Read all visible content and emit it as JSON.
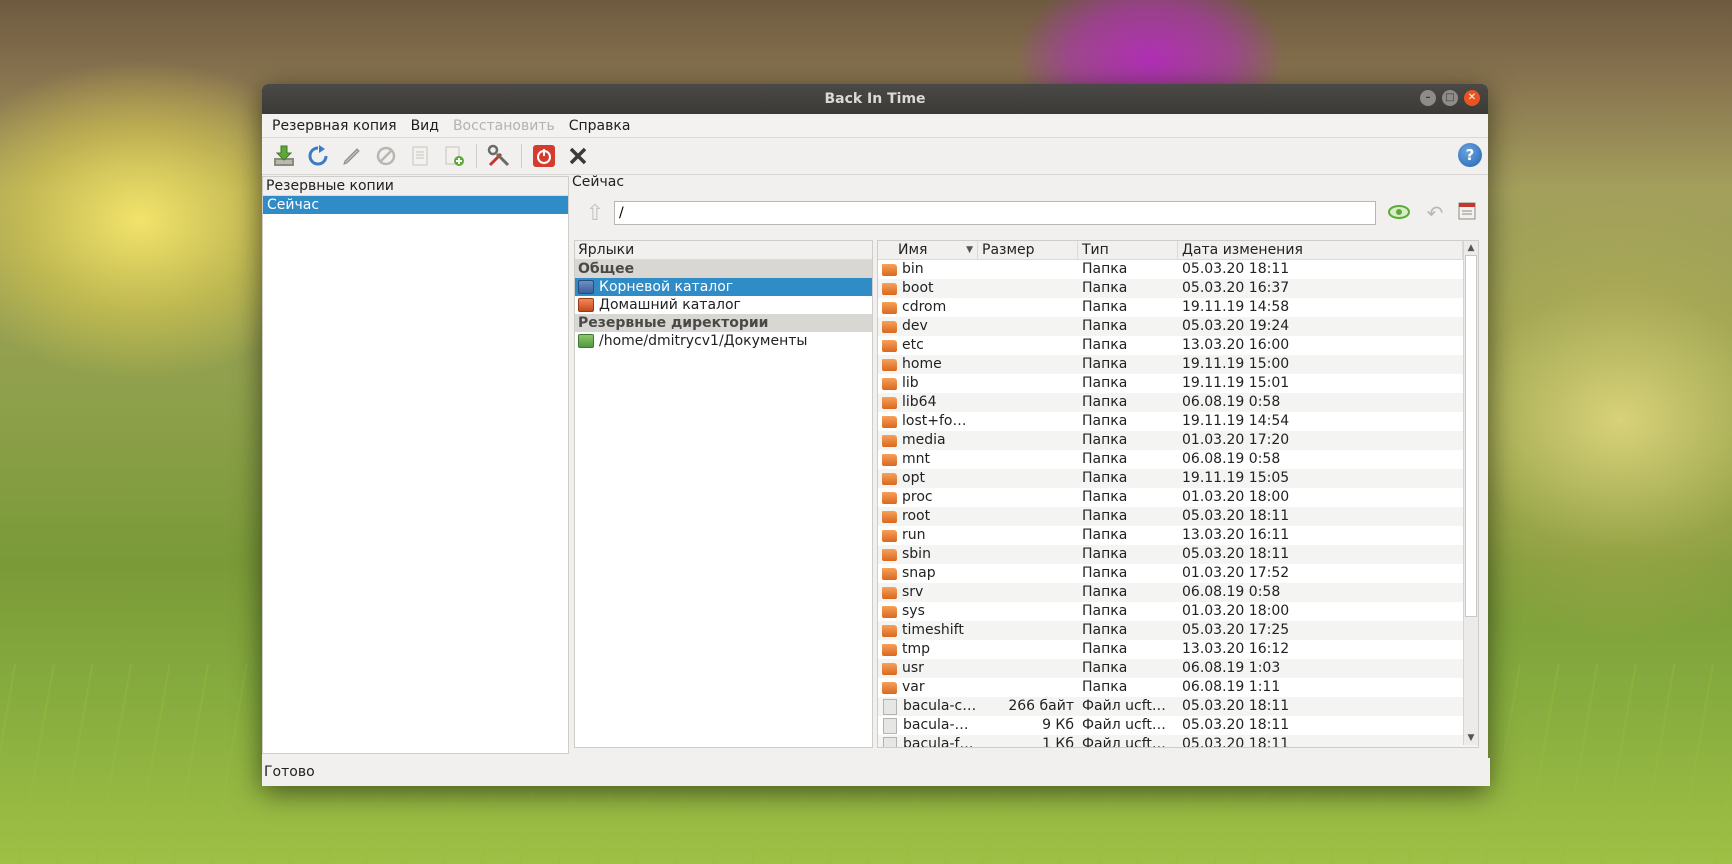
{
  "window": {
    "title": "Back In Time"
  },
  "menu": [
    {
      "label": "Резервная копия",
      "disabled": false
    },
    {
      "label": "Вид",
      "disabled": false
    },
    {
      "label": "Восстановить",
      "disabled": true
    },
    {
      "label": "Справка",
      "disabled": false
    }
  ],
  "toolbar": {
    "icons": [
      "take-snapshot-icon",
      "refresh-icon",
      "edit-name-icon",
      "remove-snapshot-icon",
      "view-log-icon",
      "view-last-log-icon",
      "settings-icon",
      "shutdown-icon",
      "exit-icon"
    ]
  },
  "snapshots": {
    "header": "Резервные копии",
    "items": [
      "Сейчас"
    ],
    "selected_index": 0
  },
  "current": {
    "label": "Сейчас",
    "path": "/"
  },
  "places": {
    "header": "Ярлыки",
    "rows": [
      {
        "label": "Общее",
        "group": true
      },
      {
        "label": "Корневой каталог",
        "icon": "monitor-icon",
        "selected": true
      },
      {
        "label": "Домашний каталог",
        "icon": "home-icon"
      },
      {
        "label": "Резервные директории",
        "group": true
      },
      {
        "label": "/home/dmitrycv1/Документы",
        "icon": "backup-folder-icon"
      }
    ]
  },
  "files": {
    "columns": [
      "Имя",
      "Размер",
      "Тип",
      "Дата изменения"
    ],
    "rows": [
      {
        "name": "bin",
        "size": "",
        "type": "Папка",
        "date": "05.03.20 18:11",
        "kind": "folder"
      },
      {
        "name": "boot",
        "size": "",
        "type": "Папка",
        "date": "05.03.20 16:37",
        "kind": "folder"
      },
      {
        "name": "cdrom",
        "size": "",
        "type": "Папка",
        "date": "19.11.19 14:58",
        "kind": "folder"
      },
      {
        "name": "dev",
        "size": "",
        "type": "Папка",
        "date": "05.03.20 19:24",
        "kind": "folder"
      },
      {
        "name": "etc",
        "size": "",
        "type": "Папка",
        "date": "13.03.20 16:00",
        "kind": "folder"
      },
      {
        "name": "home",
        "size": "",
        "type": "Папка",
        "date": "19.11.19 15:00",
        "kind": "folder"
      },
      {
        "name": "lib",
        "size": "",
        "type": "Папка",
        "date": "19.11.19 15:01",
        "kind": "folder"
      },
      {
        "name": "lib64",
        "size": "",
        "type": "Папка",
        "date": "06.08.19 0:58",
        "kind": "folder"
      },
      {
        "name": "lost+fo…",
        "size": "",
        "type": "Папка",
        "date": "19.11.19 14:54",
        "kind": "folder"
      },
      {
        "name": "media",
        "size": "",
        "type": "Папка",
        "date": "01.03.20 17:20",
        "kind": "folder"
      },
      {
        "name": "mnt",
        "size": "",
        "type": "Папка",
        "date": "06.08.19 0:58",
        "kind": "folder"
      },
      {
        "name": "opt",
        "size": "",
        "type": "Папка",
        "date": "19.11.19 15:05",
        "kind": "folder"
      },
      {
        "name": "proc",
        "size": "",
        "type": "Папка",
        "date": "01.03.20 18:00",
        "kind": "folder"
      },
      {
        "name": "root",
        "size": "",
        "type": "Папка",
        "date": "05.03.20 18:11",
        "kind": "folder"
      },
      {
        "name": "run",
        "size": "",
        "type": "Папка",
        "date": "13.03.20 16:11",
        "kind": "folder"
      },
      {
        "name": "sbin",
        "size": "",
        "type": "Папка",
        "date": "05.03.20 18:11",
        "kind": "folder"
      },
      {
        "name": "snap",
        "size": "",
        "type": "Папка",
        "date": "01.03.20 17:52",
        "kind": "folder"
      },
      {
        "name": "srv",
        "size": "",
        "type": "Папка",
        "date": "06.08.19 0:58",
        "kind": "folder"
      },
      {
        "name": "sys",
        "size": "",
        "type": "Папка",
        "date": "01.03.20 18:00",
        "kind": "folder"
      },
      {
        "name": "timeshift",
        "size": "",
        "type": "Папка",
        "date": "05.03.20 17:25",
        "kind": "folder"
      },
      {
        "name": "tmp",
        "size": "",
        "type": "Папка",
        "date": "13.03.20 16:12",
        "kind": "folder"
      },
      {
        "name": "usr",
        "size": "",
        "type": "Папка",
        "date": "06.08.19 1:03",
        "kind": "folder"
      },
      {
        "name": "var",
        "size": "",
        "type": "Папка",
        "date": "06.08.19 1:11",
        "kind": "folder"
      },
      {
        "name": "bacula-c…",
        "size": "266 байт",
        "type": "Файл ucft…",
        "date": "05.03.20 18:11",
        "kind": "file"
      },
      {
        "name": "bacula-…",
        "size": "9 Кб",
        "type": "Файл ucft…",
        "date": "05.03.20 18:11",
        "kind": "file"
      },
      {
        "name": "bacula-f…",
        "size": "1 Кб",
        "type": "Файл ucft…",
        "date": "05.03.20 18:11",
        "kind": "file"
      }
    ]
  },
  "status": "Готово"
}
